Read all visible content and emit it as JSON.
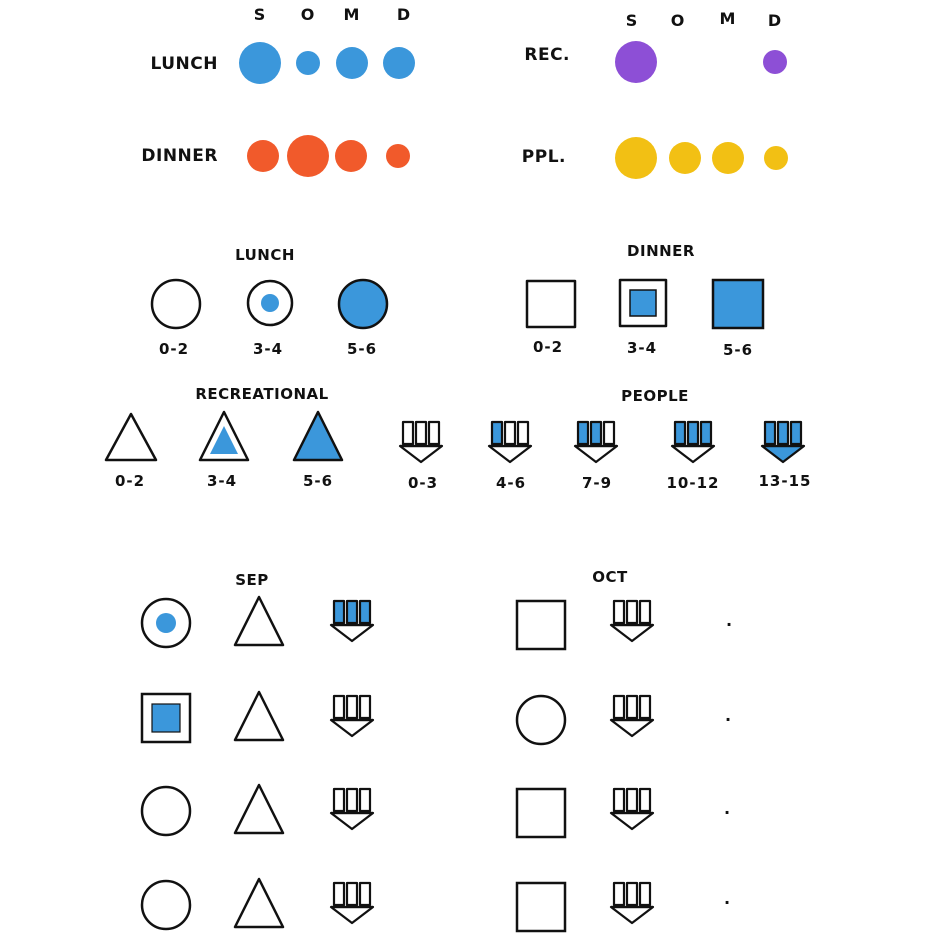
{
  "colors": {
    "blue": "#3B97DB",
    "orange": "#F15A2B",
    "purple": "#8D4FD6",
    "yellow": "#F2C014",
    "ink": "#111111"
  },
  "summary": {
    "column_headers": [
      "S",
      "O",
      "M",
      "D"
    ],
    "rows": [
      {
        "label": "LUNCH",
        "color": "blue",
        "levels": [
          3,
          1,
          2,
          2
        ]
      },
      {
        "label": "DINNER",
        "color": "orange",
        "levels": [
          2,
          3,
          2,
          1
        ]
      },
      {
        "label": "REC.",
        "color": "purple",
        "levels": [
          3,
          0,
          0,
          1
        ]
      },
      {
        "label": "PPL.",
        "color": "yellow",
        "levels": [
          3,
          2,
          2,
          1
        ]
      }
    ]
  },
  "legend": {
    "lunch": {
      "title": "LUNCH",
      "ranges": [
        "0-2",
        "3-4",
        "5-6"
      ]
    },
    "dinner": {
      "title": "DINNER",
      "ranges": [
        "0-2",
        "3-4",
        "5-6"
      ]
    },
    "recreational": {
      "title": "RECREATIONAL",
      "ranges": [
        "0-2",
        "3-4",
        "5-6"
      ]
    },
    "people": {
      "title": "PEOPLE",
      "ranges": [
        "0-3",
        "4-6",
        "7-9",
        "10-12",
        "13-15"
      ]
    }
  },
  "months": {
    "sep": {
      "title": "SEP"
    },
    "oct": {
      "title": "OCT"
    }
  },
  "grid": {
    "sep_rows": [
      {
        "meal": "circle",
        "meal_level": 1,
        "rec_level": 0,
        "people_level": 3
      },
      {
        "meal": "square",
        "meal_level": 2,
        "rec_level": 0,
        "people_level": 0
      },
      {
        "meal": "circle",
        "meal_level": 0,
        "rec_level": 0,
        "people_level": 0
      },
      {
        "meal": "circle",
        "meal_level": 0,
        "rec_level": 0,
        "people_level": 0
      }
    ],
    "oct_rows": [
      {
        "meal": "square",
        "meal_level": 0,
        "people_level": 0,
        "dot": "."
      },
      {
        "meal": "circle",
        "meal_level": 0,
        "people_level": 0,
        "dot": "."
      },
      {
        "meal": "square",
        "meal_level": 0,
        "people_level": 0,
        "dot": "."
      },
      {
        "meal": "square",
        "meal_level": 0,
        "people_level": 0,
        "dot": "."
      }
    ]
  }
}
